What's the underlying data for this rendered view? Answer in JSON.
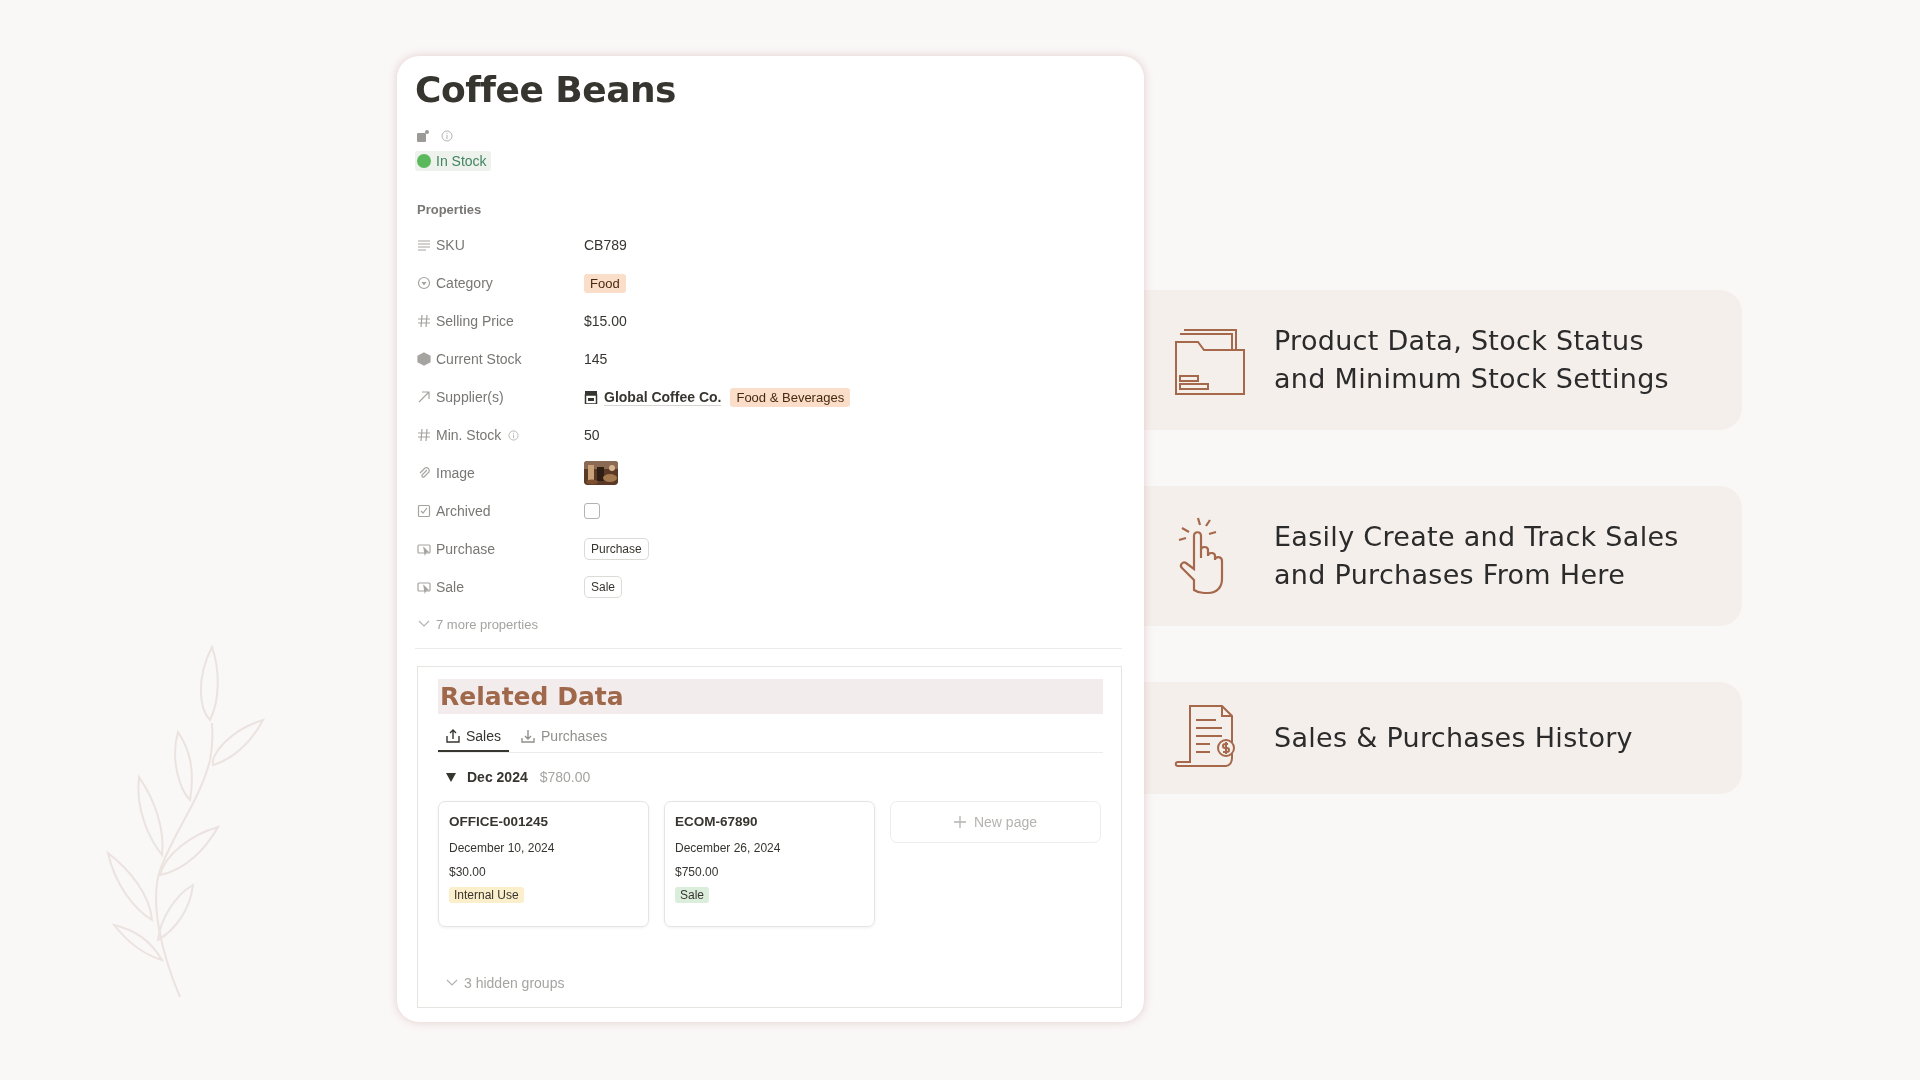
{
  "page": {
    "title": "Coffee Beans",
    "status": {
      "label": "In Stock",
      "color": "#5cb85c"
    },
    "properties_heading": "Properties",
    "properties": [
      {
        "kind": "text",
        "label": "SKU",
        "value": "CB789"
      },
      {
        "kind": "select",
        "label": "Category",
        "tag": {
          "label": "Food",
          "color": "#fadec9"
        }
      },
      {
        "kind": "number",
        "label": "Selling Price",
        "value": "$15.00"
      },
      {
        "kind": "rollup",
        "label": "Current Stock",
        "value": "145"
      },
      {
        "kind": "relation",
        "label": "Supplier(s)",
        "value": "Global Coffee Co.",
        "tag": {
          "label": "Food & Beverages",
          "color": "#fadec9"
        }
      },
      {
        "kind": "number",
        "label": "Min. Stock",
        "info": true,
        "value": "50"
      },
      {
        "kind": "files",
        "label": "Image"
      },
      {
        "kind": "checkbox",
        "label": "Archived",
        "checked": false
      },
      {
        "kind": "button",
        "label": "Purchase",
        "button": "Purchase"
      },
      {
        "kind": "button",
        "label": "Sale",
        "button": "Sale"
      }
    ],
    "more_properties": "7 more properties"
  },
  "related": {
    "heading": "Related Data",
    "tabs": [
      {
        "label": "Sales",
        "selected": true
      },
      {
        "label": "Purchases",
        "selected": false
      }
    ],
    "group": {
      "label": "Dec 2024",
      "total": "$780.00",
      "expanded": true
    },
    "cards": [
      {
        "title": "OFFICE-001245",
        "date": "December 10, 2024",
        "amount": "$30.00",
        "tag": {
          "label": "Internal Use",
          "color": "#fbeecb"
        }
      },
      {
        "title": "ECOM-67890",
        "date": "December 26, 2024",
        "amount": "$750.00",
        "tag": {
          "label": "Sale",
          "color": "#dbeddb"
        }
      }
    ],
    "new_page": "New page",
    "hidden_groups": "3 hidden groups"
  },
  "features": [
    {
      "lines": [
        "Product Data, Stock Status",
        "and Minimum Stock Settings"
      ]
    },
    {
      "lines": [
        "Easily Create and Track Sales",
        "and Purchases From Here"
      ]
    },
    {
      "lines": [
        "Sales & Purchases History"
      ]
    }
  ]
}
